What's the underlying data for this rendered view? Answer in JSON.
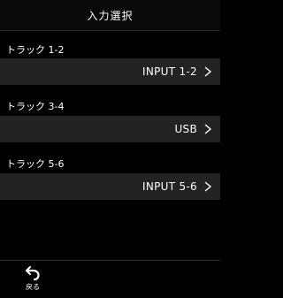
{
  "header": {
    "title": "入力選択"
  },
  "tracks": [
    {
      "label": "トラック 1-2",
      "value": "INPUT 1-2"
    },
    {
      "label": "トラック 3-4",
      "value": "USB"
    },
    {
      "label": "トラック 5-6",
      "value": "INPUT 5-6"
    }
  ],
  "footer": {
    "back_label": "戻る"
  },
  "icons": {
    "row_chevron": "chevron-right-icon",
    "back": "back-arrow-icon"
  },
  "colors": {
    "background": "#000000",
    "row_background": "#232323",
    "text": "#ffffff"
  }
}
